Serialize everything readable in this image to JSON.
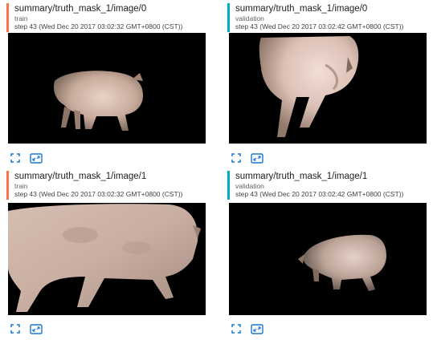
{
  "cards": [
    {
      "title": "summary/truth_mask_1/image/0",
      "run": "train",
      "step": "step 43 (Wed Dec 20 2017 03:02:32 GMT+0800 (CST))",
      "image_subject": "pig",
      "run_color": "#ff7043"
    },
    {
      "title": "summary/truth_mask_1/image/0",
      "run": "validation",
      "step": "step 43 (Wed Dec 20 2017 03:02:42 GMT+0800 (CST))",
      "image_subject": "pig",
      "run_color": "#00acc1"
    },
    {
      "title": "summary/truth_mask_1/image/1",
      "run": "train",
      "step": "step 43 (Wed Dec 20 2017 03:02:32 GMT+0800 (CST))",
      "image_subject": "pig",
      "run_color": "#ff7043"
    },
    {
      "title": "summary/truth_mask_1/image/1",
      "run": "validation",
      "step": "step 43 (Wed Dec 20 2017 03:02:42 GMT+0800 (CST))",
      "image_subject": "pig",
      "run_color": "#00acc1"
    }
  ],
  "icons": {
    "fit": "fit-to-screen-icon",
    "actual_size": "actual-size-icon",
    "icon_color": "#1976d2"
  }
}
